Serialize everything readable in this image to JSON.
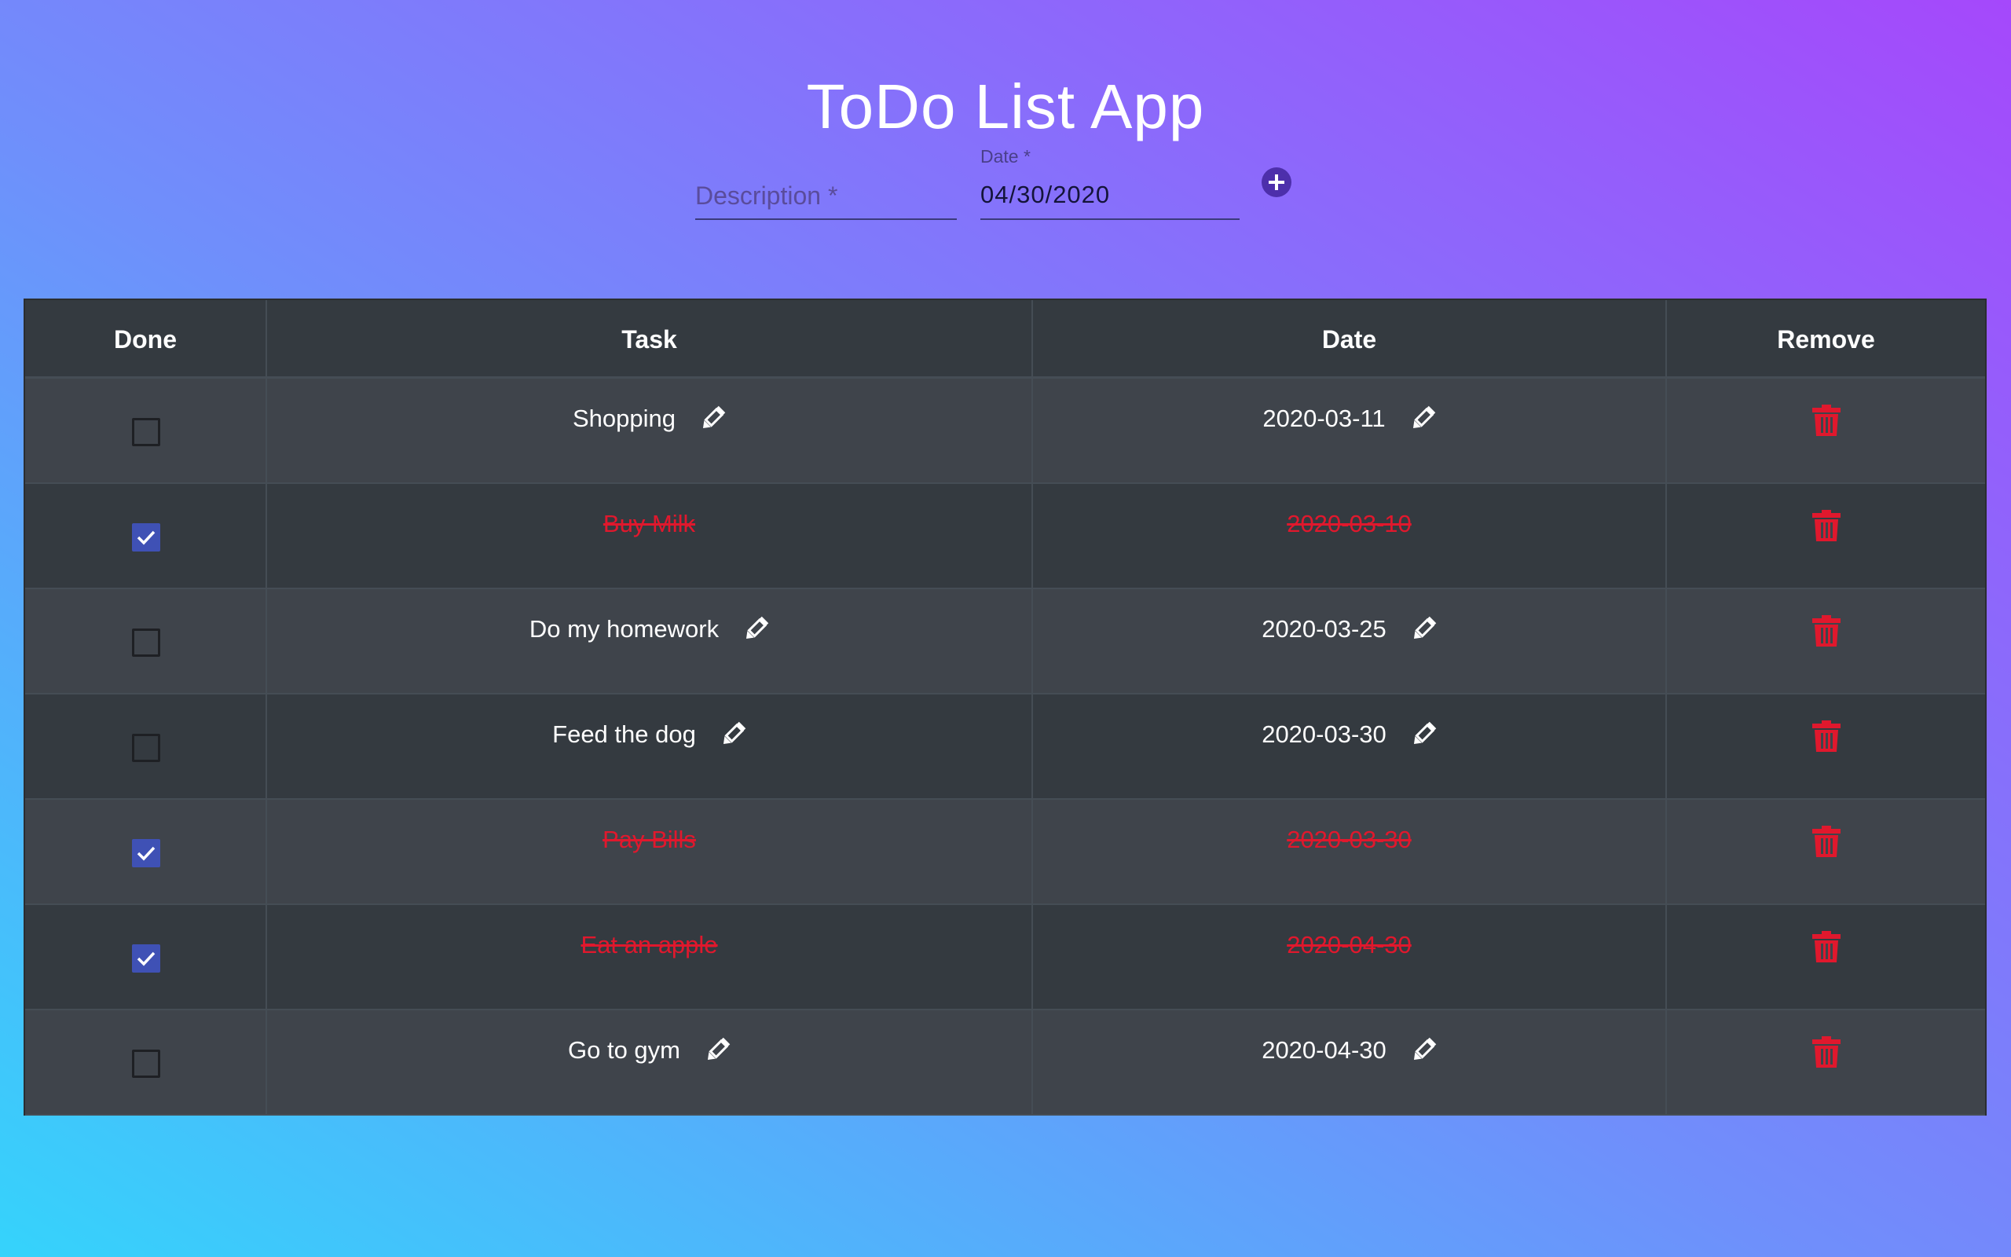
{
  "app": {
    "title": "ToDo List App"
  },
  "form": {
    "description_placeholder": "Description *",
    "date_label": "Date *",
    "date_value": "04/30/2020",
    "add_icon": "plus-circle-icon"
  },
  "table": {
    "headers": [
      "Done",
      "Task",
      "Date",
      "Remove"
    ],
    "rows": [
      {
        "done": false,
        "task": "Shopping",
        "date": "2020-03-11"
      },
      {
        "done": true,
        "task": "Buy Milk",
        "date": "2020-03-10"
      },
      {
        "done": false,
        "task": "Do my homework",
        "date": "2020-03-25"
      },
      {
        "done": false,
        "task": "Feed the dog",
        "date": "2020-03-30"
      },
      {
        "done": true,
        "task": "Pay Bills",
        "date": "2020-03-30"
      },
      {
        "done": true,
        "task": "Eat an apple",
        "date": "2020-04-30"
      },
      {
        "done": false,
        "task": "Go to gym",
        "date": "2020-04-30"
      }
    ],
    "icons": {
      "edit": "pencil-icon",
      "remove": "trash-icon",
      "checked": "checkmark-icon"
    }
  },
  "colors": {
    "gradient_start": "#35d3fb",
    "gradient_end": "#a548fb",
    "table_header": "#343a40",
    "row_light": "#3f444b",
    "row_dark": "#343a40",
    "done_text": "#e0182d",
    "checkbox_checked": "#3f51b5",
    "trash": "#e0182d",
    "add_button": "#4d2fab"
  }
}
